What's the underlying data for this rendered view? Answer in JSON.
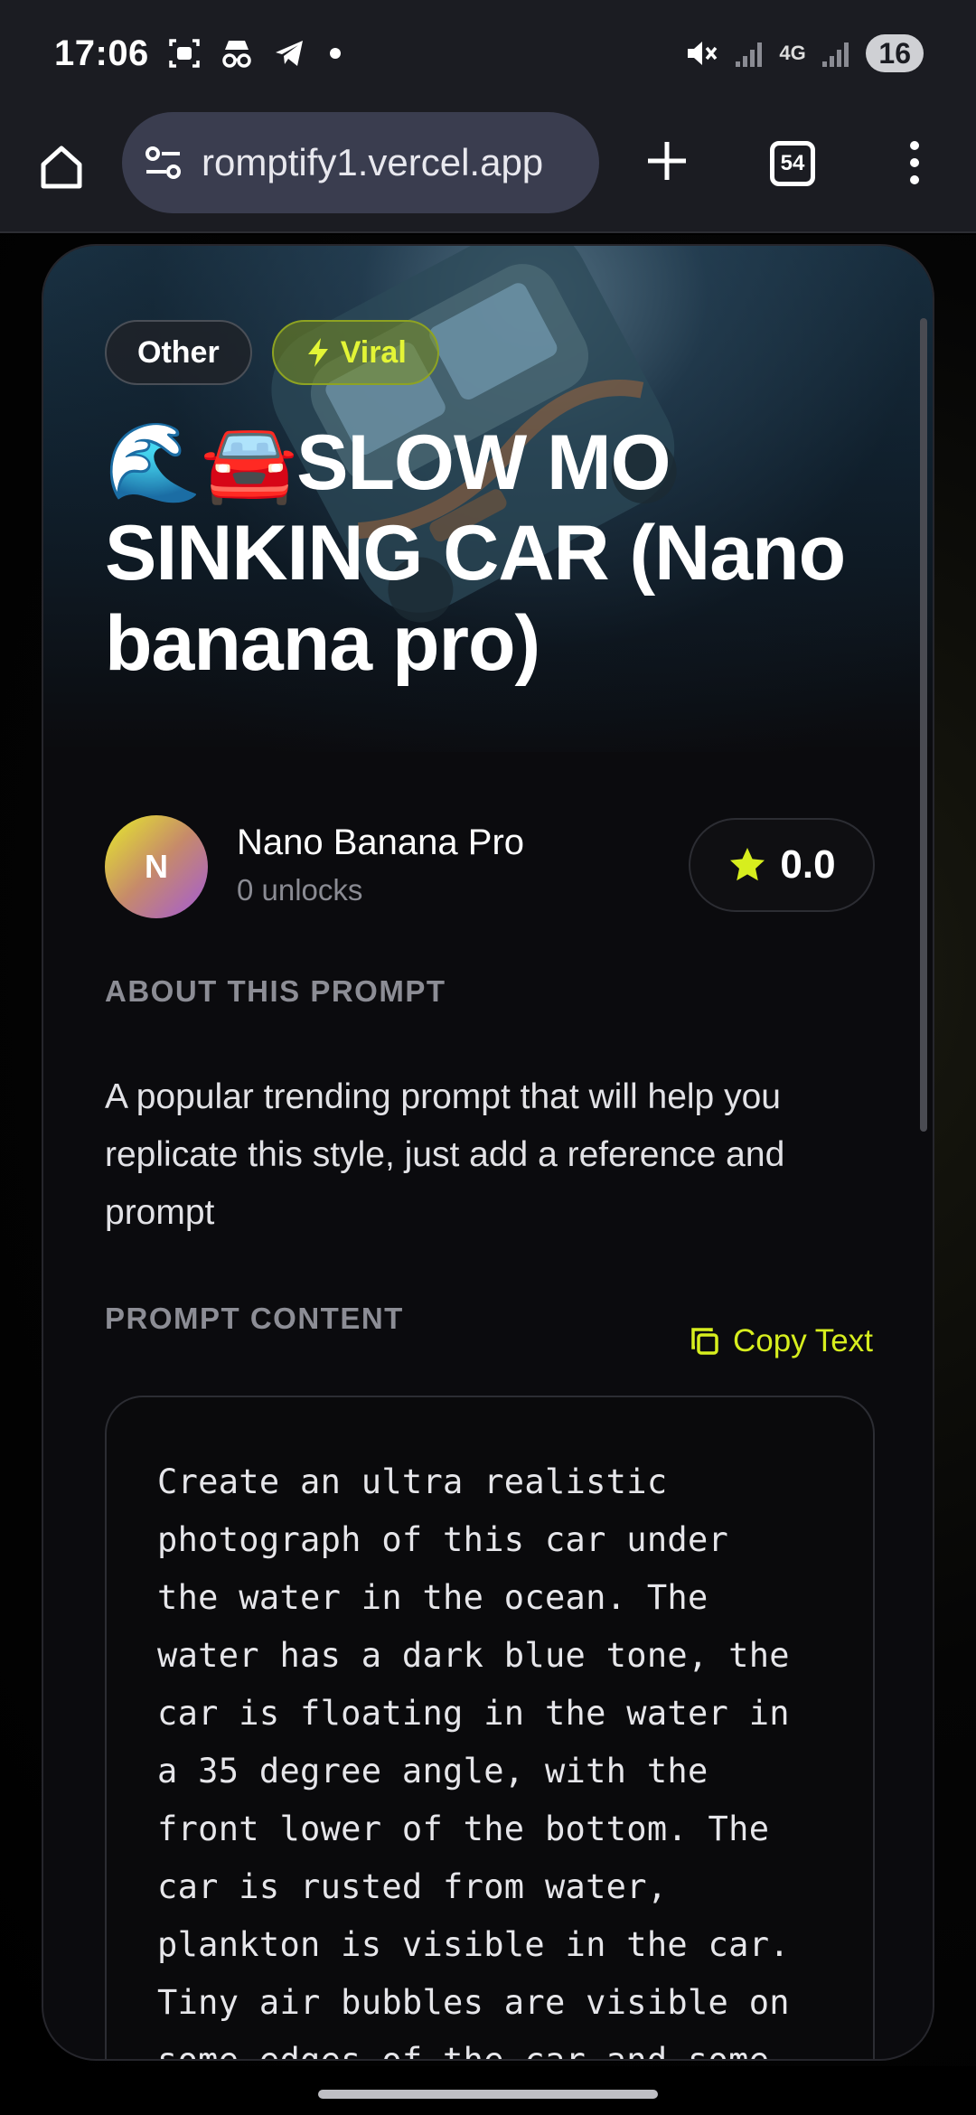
{
  "status_bar": {
    "time": "17:06",
    "network": "4G",
    "battery": "16"
  },
  "browser": {
    "url": "romptify1.vercel.app",
    "tab_count": "54"
  },
  "card": {
    "tags": [
      {
        "label": "Other"
      },
      {
        "label": "Viral",
        "icon": "lightning-icon"
      }
    ],
    "title": "🌊🚘SLOW MO SINKING CAR (Nano banana pro)",
    "author": {
      "initial": "N",
      "name": "Nano Banana Pro",
      "unlocks": "0 unlocks"
    },
    "rating": "0.0",
    "about_label": "ABOUT THIS PROMPT",
    "about_text": "A popular trending prompt that will help you replicate this style, just add a reference and prompt",
    "prompt_label": "PROMPT CONTENT",
    "copy_label": "Copy Text",
    "prompt_text": "Create an ultra realistic\nphotograph of this car under\nthe water in the ocean. The\nwater has a dark blue tone, the\ncar is floating in the water in\na 35 degree angle, with the\nfront lower of the bottom. The\ncar is rusted from water,\nplankton is visible in the car.\nTiny air bubbles are visible on\nsome edges of the car and some"
  },
  "colors": {
    "accent": "#d7ee1e",
    "background": "#0b0b0e",
    "browser_bar": "#1b1c22",
    "url_pill": "#3a3d4f"
  }
}
